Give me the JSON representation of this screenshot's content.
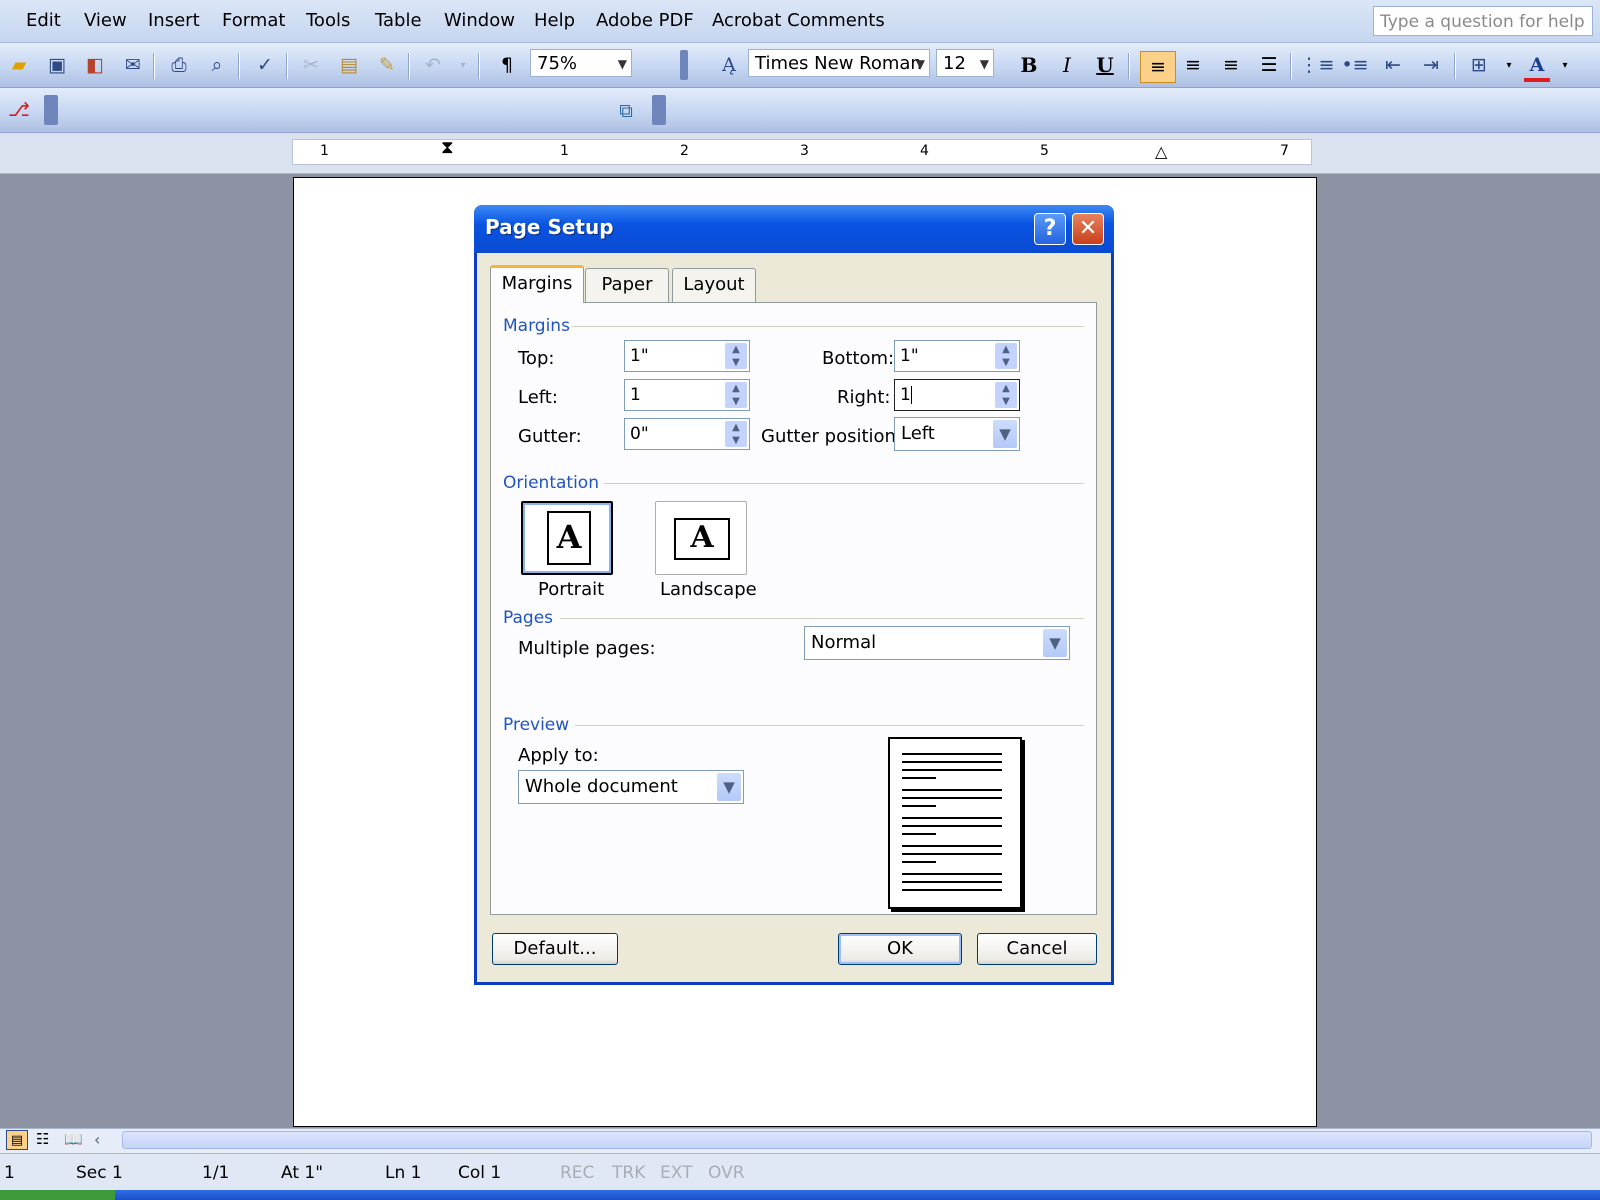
{
  "menu": {
    "items": [
      "Edit",
      "View",
      "Insert",
      "Format",
      "Tools",
      "Table",
      "Window",
      "Help",
      "Adobe PDF",
      "Acrobat Comments"
    ],
    "help_placeholder": "Type a question for help"
  },
  "toolbar": {
    "zoom": "75%",
    "font_name": "Times New Roman",
    "font_size": "12",
    "bold": "B",
    "italic": "I",
    "underline": "U"
  },
  "ruler": {
    "numbers": [
      "1",
      "1",
      "2",
      "3",
      "4",
      "5",
      "7"
    ]
  },
  "dialog": {
    "title": "Page Setup",
    "help_glyph": "?",
    "close_glyph": "✕",
    "tabs": [
      "Margins",
      "Paper",
      "Layout"
    ],
    "margins": {
      "group": "Margins",
      "top_label": "Top:",
      "top_value": "1\"",
      "bottom_label": "Bottom:",
      "bottom_value": "1\"",
      "left_label": "Left:",
      "left_value": "1",
      "right_label": "Right:",
      "right_value": "1",
      "gutter_label": "Gutter:",
      "gutter_value": "0\"",
      "gutter_position_label": "Gutter position:",
      "gutter_position_value": "Left"
    },
    "orientation": {
      "group": "Orientation",
      "portrait": "Portrait",
      "landscape": "Landscape",
      "glyph": "A",
      "selected": "Portrait"
    },
    "pages": {
      "group": "Pages",
      "multiple_label": "Multiple pages:",
      "multiple_value": "Normal"
    },
    "preview": {
      "group": "Preview",
      "apply_label": "Apply to:",
      "apply_value": "Whole document"
    },
    "buttons": {
      "default": "Default...",
      "ok": "OK",
      "cancel": "Cancel"
    }
  },
  "status": {
    "page": "1",
    "sec": "Sec 1",
    "page_of": "1/1",
    "at": "At 1\"",
    "ln": "Ln 1",
    "col": "Col 1",
    "rec": "REC",
    "trk": "TRK",
    "ext": "EXT",
    "ovr": "OVR"
  },
  "colors": {
    "title_bar": "#0954e2",
    "accent_label": "#2154c0",
    "desktop": "#8d93a2"
  }
}
